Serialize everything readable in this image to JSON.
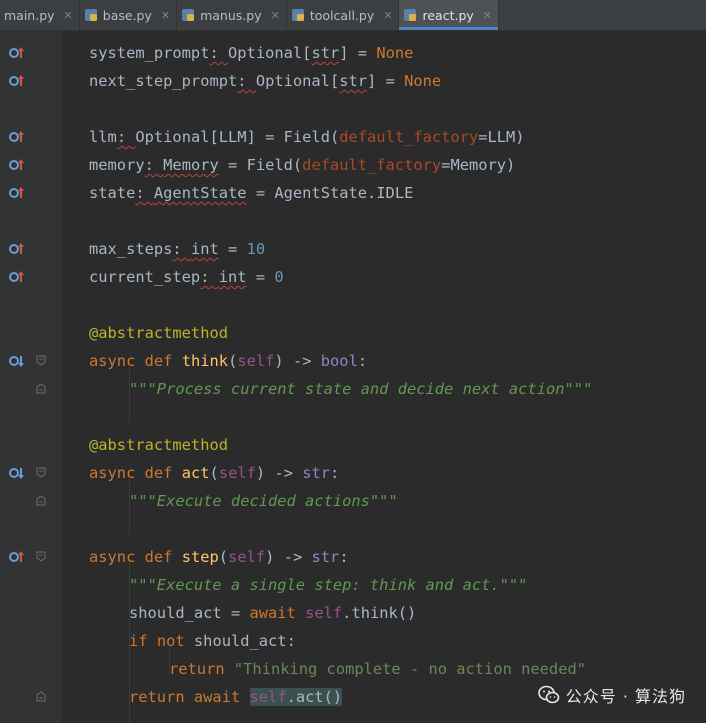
{
  "tabs": [
    {
      "label": "main.py",
      "active": false
    },
    {
      "label": "base.py",
      "active": false
    },
    {
      "label": "manus.py",
      "active": false
    },
    {
      "label": "toolcall.py",
      "active": false
    },
    {
      "label": "react.py",
      "active": true
    }
  ],
  "watermark": {
    "text": "公众号 · 算法狗",
    "icon": "wechat-icon"
  },
  "code_lines": [
    "    system_prompt: Optional[str] = None",
    "    next_step_prompt: Optional[str] = None",
    "",
    "    llm: Optional[LLM] = Field(default_factory=LLM)",
    "    memory: Memory = Field(default_factory=Memory)",
    "    state: AgentState = AgentState.IDLE",
    "",
    "    max_steps: int = 10",
    "    current_step: int = 0",
    "",
    "    @abstractmethod",
    "    async def think(self) -> bool:",
    "        \"\"\"Process current state and decide next action\"\"\"",
    "",
    "    @abstractmethod",
    "    async def act(self) -> str:",
    "        \"\"\"Execute decided actions\"\"\"",
    "",
    "    async def step(self) -> str:",
    "        \"\"\"Execute a single step: think and act.\"\"\"",
    "        should_act = await self.think()",
    "        if not should_act:",
    "            return \"Thinking complete - no action needed\"",
    "        return await self.act()"
  ],
  "tokens": {
    "l0": [
      "system_prompt",
      ": ",
      "Optional",
      "[",
      "str",
      "] = ",
      "None"
    ],
    "l1": [
      "next_step_prompt",
      ": ",
      "Optional",
      "[",
      "str",
      "] = ",
      "None"
    ],
    "l3": [
      "llm",
      ": ",
      "Optional",
      "[LLM] = Field(",
      "default_factory",
      "=LLM)"
    ],
    "l4": [
      "memory",
      ": ",
      "Memory",
      " = Field(",
      "default_factory",
      "=Memory)"
    ],
    "l5": [
      "state",
      ": ",
      "AgentState",
      " = AgentState.IDLE"
    ],
    "l7": [
      "max_steps",
      ": ",
      "int",
      " = ",
      "10"
    ],
    "l8": [
      "current_step",
      ": ",
      "int",
      " = ",
      "0"
    ],
    "l10": [
      "@abstractmethod"
    ],
    "l11": [
      "async",
      " ",
      "def",
      " ",
      "think",
      "(",
      "self",
      ") -> ",
      "bool",
      ":"
    ],
    "l12": [
      "\"\"\"Process current state and decide next action\"\"\""
    ],
    "l14": [
      "@abstractmethod"
    ],
    "l15": [
      "async",
      " ",
      "def",
      " ",
      "act",
      "(",
      "self",
      ") -> ",
      "str",
      ":"
    ],
    "l16": [
      "\"\"\"Execute decided actions\"\"\""
    ],
    "l18": [
      "async",
      " ",
      "def",
      " ",
      "step",
      "(",
      "self",
      ") -> ",
      "str",
      ":"
    ],
    "l19": [
      "\"\"\"Execute a single step: think and act.\"\"\""
    ],
    "l20": [
      "should_act = ",
      "await",
      " ",
      "self",
      ".think()"
    ],
    "l21": [
      "if",
      " ",
      "not",
      " should_act:"
    ],
    "l22": [
      "return",
      " ",
      "\"Thinking complete - no action needed\""
    ],
    "l23": [
      "return",
      " ",
      "await",
      " ",
      "self",
      ".act()"
    ]
  },
  "gutter_icons": {
    "override": "override-up-icon",
    "implemented": "implemented-down-icon",
    "fold": "fold-marker-icon"
  },
  "colors": {
    "background": "#2b2b2b",
    "keyword": "#cc7832",
    "number": "#6897bb",
    "decorator": "#bbb529",
    "function": "#ffc66d",
    "self": "#94558d",
    "docstring": "#629755",
    "string": "#6a8759"
  }
}
